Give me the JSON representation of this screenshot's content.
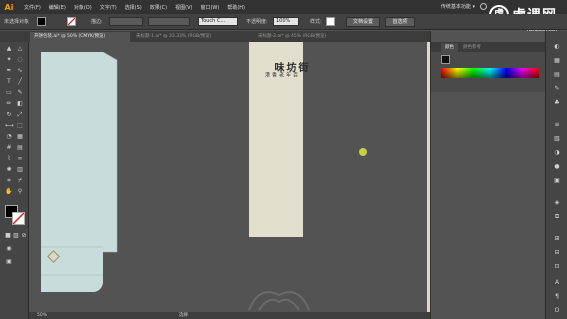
{
  "menubar": {
    "app_icon": "Ai",
    "items": [
      "文件(F)",
      "编辑(E)",
      "对象(O)",
      "文字(T)",
      "选择(S)",
      "效果(C)",
      "视图(V)",
      "窗口(W)",
      "帮助(H)"
    ],
    "workspace": "传统基本功能 ▾",
    "watermark_logo": "虎",
    "watermark_text": "虎课网",
    "watermark_sub": "HUKE88.COM"
  },
  "controlbar": {
    "selection_label": "未选择对象",
    "stroke_label": "描边:",
    "brush_label": "Touch C...",
    "opacity_label": "不透明度:",
    "opacity_value": "100%",
    "style_label": "样式:",
    "doc_setup": "文档设置",
    "preferences": "首选项"
  },
  "tabs": [
    "开饼包装.ai* @ 50% (CMYK/预览)",
    "未标题-1.ai* @ 33.33% (RGB/预览)",
    "未标题-2.ai* @ 45% (RGB/预览)"
  ],
  "artwork": {
    "title": "街坊味",
    "subtitle": "百年老香港"
  },
  "statusbar": {
    "zoom": "50%",
    "tool": "选择"
  },
  "panel": {
    "tab_color": "颜色",
    "tab_color_guide": "颜色参考"
  },
  "colors": {
    "canvas": "#535353",
    "artboard_light_blue": "#c8dcdc",
    "artboard_cream": "#e3dfcf",
    "app_logo": "#ff9a00"
  }
}
